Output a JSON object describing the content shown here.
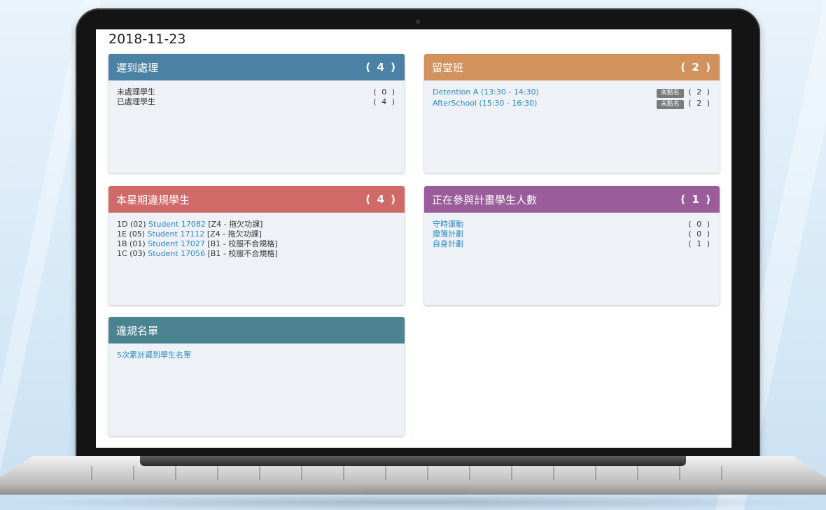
{
  "colors": {
    "late": "#4a81a4",
    "detention": "#d1925d",
    "weekly": "#cf6a69",
    "programs": "#9a5c9a",
    "list": "#4b8391",
    "link": "#2b89c8"
  },
  "date": "2018-11-23",
  "late_panel": {
    "title": "遲到處理",
    "count": "( 4 )",
    "rows": [
      {
        "label": "未處理學生",
        "count": "( 0 )"
      },
      {
        "label": "已處理學生",
        "count": "( 4 )"
      }
    ]
  },
  "detention_panel": {
    "title": "留堂班",
    "count": "( 2 )",
    "rows": [
      {
        "label": "Detention A (13:30 - 14:30)",
        "badge": "未點名",
        "count": "( 2 )"
      },
      {
        "label": "AfterSchool (15:30 - 16:30)",
        "badge": "未點名",
        "count": "( 2 )"
      }
    ]
  },
  "weekly_panel": {
    "title": "本星期違規學生",
    "count": "( 4 )",
    "rows": [
      {
        "cls": "1D (02)",
        "student": "Student 17082",
        "rule": "[Z4 - 拖欠功課]"
      },
      {
        "cls": "1E (05)",
        "student": "Student 17112",
        "rule": "[Z4 - 拖欠功課]"
      },
      {
        "cls": "1B (01)",
        "student": "Student 17027",
        "rule": "[B1 - 校服不合規格]"
      },
      {
        "cls": "1C (03)",
        "student": "Student 17056",
        "rule": "[B1 - 校服不合規格]"
      }
    ]
  },
  "programs_panel": {
    "title": "正在參與計畫學生人數",
    "count": "( 1 )",
    "rows": [
      {
        "label": "守時運動",
        "count": "( 0 )"
      },
      {
        "label": "撥簿計劃",
        "count": "( 0 )"
      },
      {
        "label": "自身計劃",
        "count": "( 1 )"
      }
    ]
  },
  "list_panel": {
    "title": "違規名單",
    "link": "5次累計遲到學生名單"
  }
}
